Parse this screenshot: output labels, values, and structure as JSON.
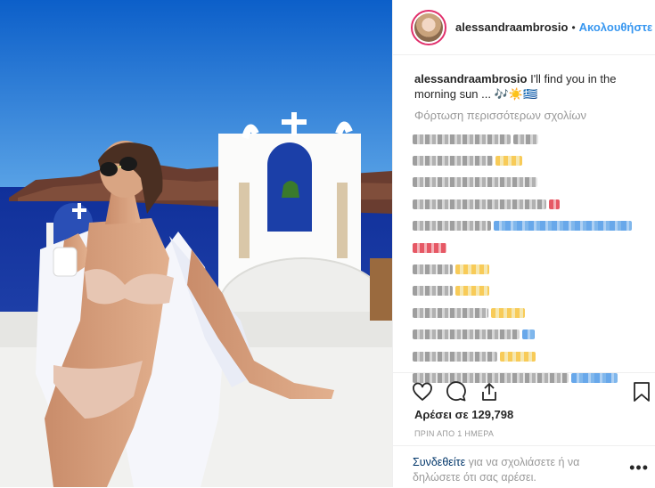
{
  "post": {
    "username": "alessandraambrosio",
    "separator": "•",
    "follow_label": "Ακολουθήστε",
    "caption_text": "I'll find you in the morning sun ... 🎶☀️🇬🇷",
    "load_more_comments": "Φόρτωση περισσότερων σχολίων",
    "likes_text": "Αρέσει σε 129,798",
    "timestamp": "ΠΡΙΝ ΑΠΟ 1 ΗΜΕΡΑ",
    "login_link": "Συνδεθείτε",
    "login_rest": " για να σχολιάσετε ή να δηλώσετε ότι σας αρέσει.",
    "more_options": "•••"
  },
  "icons": {
    "like": "heart-icon",
    "comment": "comment-icon",
    "share": "share-icon",
    "save": "bookmark-icon",
    "more": "more-options-icon"
  },
  "colors": {
    "link_blue": "#3897f0",
    "login_blue": "#003569",
    "muted_gray": "#999999",
    "story_ring": "#e1306c"
  }
}
